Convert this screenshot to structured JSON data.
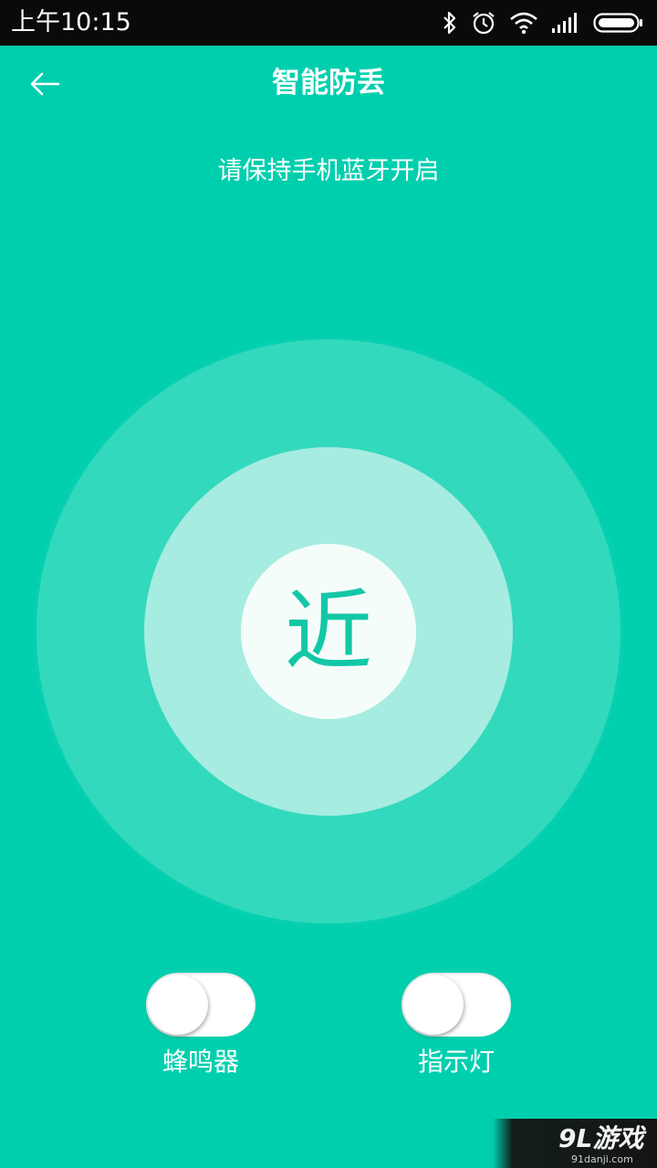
{
  "status_bar": {
    "time": "上午10:15",
    "icons": [
      "bluetooth-icon",
      "alarm-icon",
      "wifi-icon",
      "signal-icon",
      "battery-icon"
    ]
  },
  "app_bar": {
    "back_icon": "arrow-left-icon",
    "title": "智能防丢"
  },
  "hint": "请保持手机蓝牙开启",
  "proximity": {
    "distance_label": "近"
  },
  "controls": {
    "buzzer": {
      "label": "蜂鸣器",
      "on": false
    },
    "indicator_light": {
      "label": "指示灯",
      "on": false
    }
  },
  "watermark": {
    "logo": "9L游戏",
    "domain": "91danji.com"
  },
  "colors": {
    "background": "#00cfae",
    "outer_ring": "#33d9bd",
    "middle_ring": "#a6ece0",
    "inner_circle": "#f5fdfb",
    "accent_text": "#13c7a6",
    "status_bar": "#0a0a0a"
  }
}
